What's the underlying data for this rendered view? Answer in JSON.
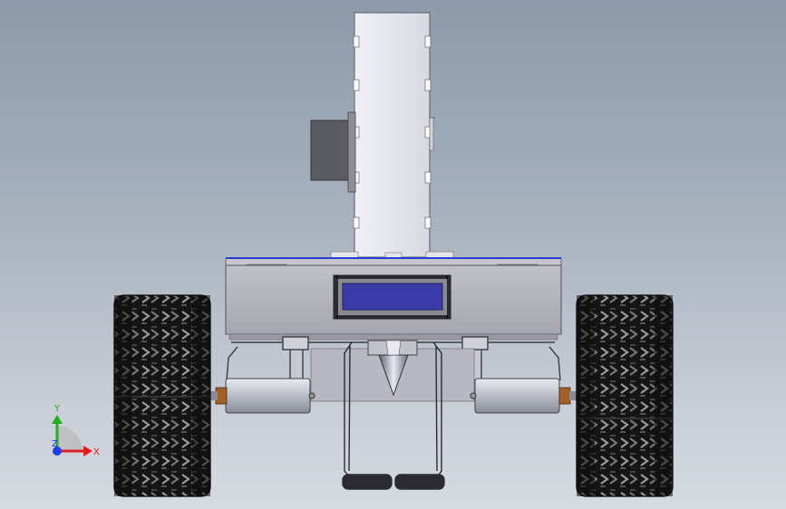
{
  "viewport": {
    "background_top": "#8c9aab",
    "background_bottom": "#d6dae1"
  },
  "model": {
    "chassis_color": "#b4b4bc",
    "lcd_color": "#3838a8",
    "tower_color": "#e2e2ea",
    "motor_color": "#c8cbd3",
    "tire_color": "#1a1a1a",
    "accent_edge": "#2a3ccf"
  },
  "triad": {
    "x_label": "X",
    "y_label": "Y",
    "z_label": "Z",
    "x_color": "#e02020",
    "y_color": "#20b020",
    "z_color": "#2040e0"
  }
}
